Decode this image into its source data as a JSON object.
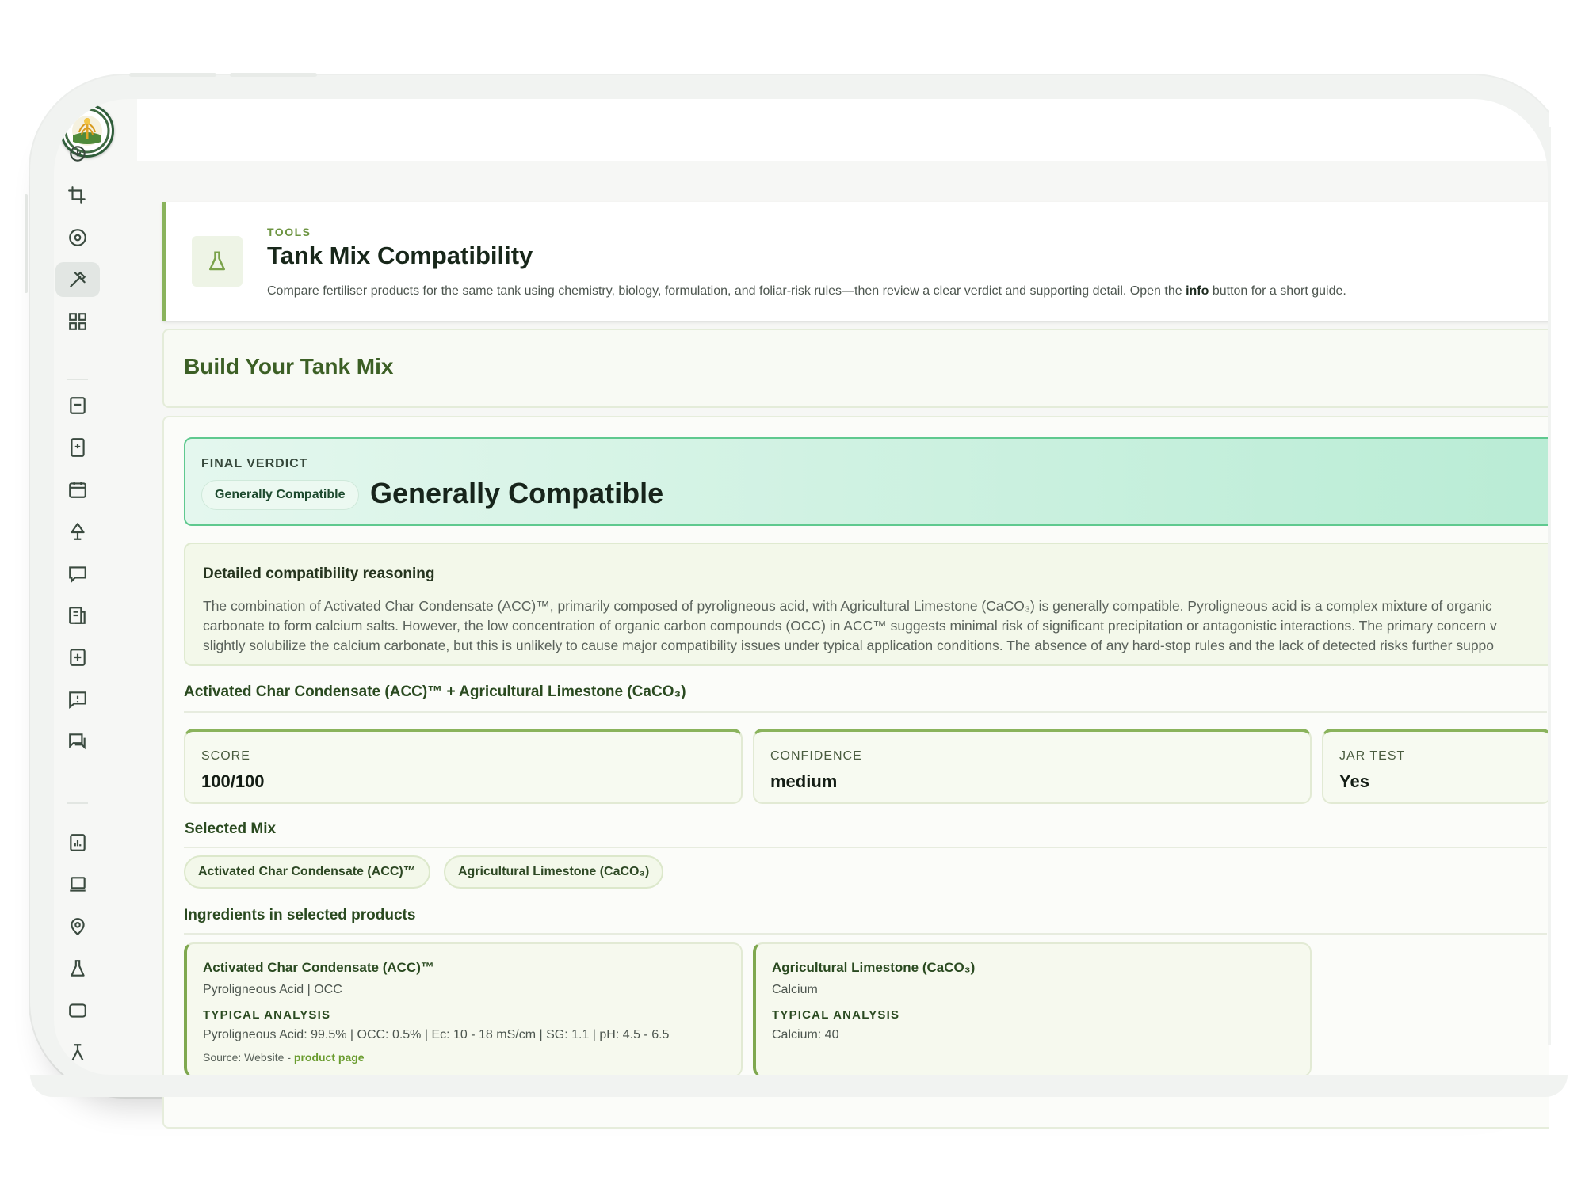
{
  "header": {
    "eyebrow": "TOOLS",
    "title": "Tank Mix Compatibility",
    "description_before": "Compare fertiliser products for the same tank using chemistry, biology, formulation, and foliar-risk rules—then review a clear verdict and supporting detail. Open the ",
    "description_bold": "info",
    "description_after": " button for a short guide.",
    "icon": "flask-icon"
  },
  "build": {
    "title": "Build Your Tank Mix"
  },
  "verdict": {
    "label": "FINAL VERDICT",
    "badge": "Generally Compatible",
    "title": "Generally Compatible",
    "colors": {
      "border": "#5fc98f",
      "start": "#e4f7ee",
      "end": "#b9ecd5"
    }
  },
  "reasoning": {
    "title": "Detailed compatibility reasoning",
    "lines": [
      "The combination of Activated Char Condensate (ACC)™, primarily composed of pyroligneous acid, with Agricultural Limestone (CaCO₃) is generally compatible. Pyroligneous acid is a complex mixture of organic",
      "carbonate to form calcium salts. However, the low concentration of organic carbon compounds (OCC) in ACC™ suggests minimal risk of significant precipitation or antagonistic interactions. The primary concern v",
      "slightly solubilize the calcium carbonate, but this is unlikely to cause major compatibility issues under typical application conditions. The absence of any hard-stop rules and the lack of detected risks further suppo"
    ]
  },
  "combination": {
    "title": "Activated Char Condensate (ACC)™ + Agricultural Limestone (CaCO₃)"
  },
  "stats": [
    {
      "label": "SCORE",
      "value": "100/100"
    },
    {
      "label": "CONFIDENCE",
      "value": "medium"
    },
    {
      "label": "JAR TEST",
      "value": "Yes"
    }
  ],
  "selected_mix": {
    "title": "Selected Mix",
    "chips": [
      "Activated Char Condensate (ACC)™",
      "Agricultural Limestone (CaCO₃)"
    ]
  },
  "ingredients": {
    "title": "Ingredients in selected products",
    "items": [
      {
        "name": "Activated Char Condensate (ACC)™",
        "sub": "Pyroligneous Acid | OCC",
        "analysis_label": "TYPICAL ANALYSIS",
        "analysis": "Pyroligneous Acid: 99.5% | OCC: 0.5% | Ec: 10 - 18 mS/cm | SG: 1.1 | pH: 4.5 - 6.5",
        "source_prefix": "Source: Website - ",
        "source_link": "product page"
      },
      {
        "name": "Agricultural Limestone (CaCO₃)",
        "sub": "Calcium",
        "analysis_label": "TYPICAL ANALYSIS",
        "analysis": "Calcium: 40"
      }
    ]
  },
  "sidebar": {
    "icons": [
      "power-icon",
      "crop-icon",
      "eye-icon",
      "tools-icon",
      "apps-icon",
      "document-icon",
      "report-icon",
      "calendar-icon",
      "plant-icon",
      "chat-icon",
      "notes-icon",
      "add-doc-icon",
      "alert-chat-icon",
      "messages-icon",
      "analytics-icon",
      "laptop-icon",
      "location-icon",
      "lab-flask-icon",
      "chat-bot-icon",
      "lab-icon"
    ]
  },
  "theme": {
    "accent": "#8ab35c",
    "text_dark": "#18271a",
    "brand_green": "#3c5f25"
  }
}
